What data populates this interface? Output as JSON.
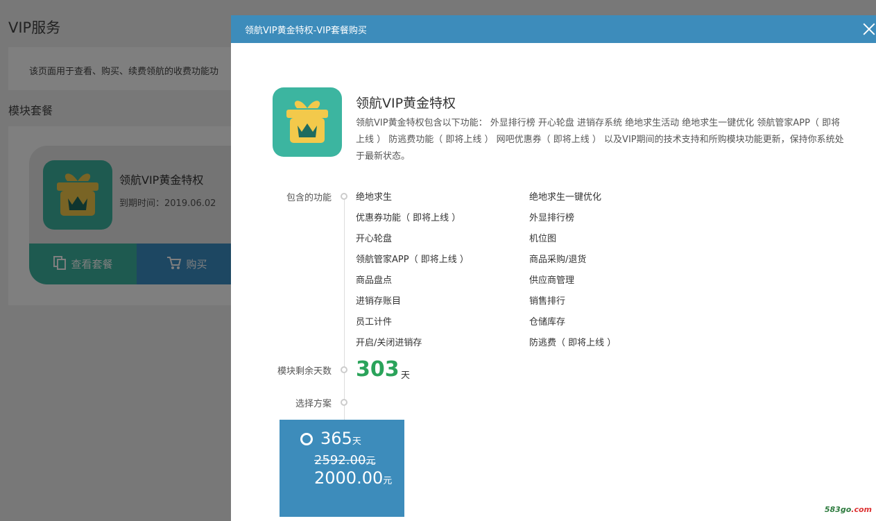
{
  "background": {
    "page_title": "VIP服务",
    "description": "该页面用于查看、购买、续费领航的收费功能功",
    "section_title": "模块套餐",
    "card": {
      "name": "领航VIP黄金特权",
      "expire_label": "到期时间：2019.06.02",
      "view_button": "查看套餐",
      "buy_button": "购买"
    }
  },
  "modal": {
    "title": "领航VIP黄金特权-VIP套餐购买",
    "product": {
      "title": "领航VIP黄金特权",
      "description": "领航VIP黄金特权包含以下功能： 外显排行榜 开心轮盘 进销存系统 绝地求生活动 绝地求生一键优化 领航管家APP（ 即将上线 ） 防逃费功能（ 即将上线 ） 网吧优惠券（ 即将上线 ） 以及VIP期间的技术支持和所购模块功能更新，保持你系统处于最新状态。"
    },
    "labels": {
      "features": "包含的功能",
      "remaining_days": "模块剩余天数",
      "choose_plan": "选择方案"
    },
    "features": [
      "绝地求生",
      "绝地求生一键优化",
      "优惠券功能（ 即将上线 ）",
      "外显排行榜",
      "开心轮盘",
      "机位图",
      "领航管家APP（ 即将上线 ）",
      "商品采购/退货",
      "商品盘点",
      "供应商管理",
      "进销存账目",
      "销售排行",
      "员工计件",
      "仓储库存",
      "开启/关闭进销存",
      "防逃费（ 即将上线 ）"
    ],
    "remaining": {
      "days": "303",
      "unit": "天"
    },
    "plan": {
      "days": "365",
      "days_unit": "天",
      "original_price": "2592.00",
      "price": "2000.00",
      "currency_unit": "元"
    }
  },
  "watermark": {
    "main": "583go",
    "suffix": ".com"
  },
  "colors": {
    "header_blue": "#3d8cbb",
    "teal": "#3cb5a0",
    "green_days": "#2aa35a",
    "gift_yellow": "#f3c94b"
  }
}
